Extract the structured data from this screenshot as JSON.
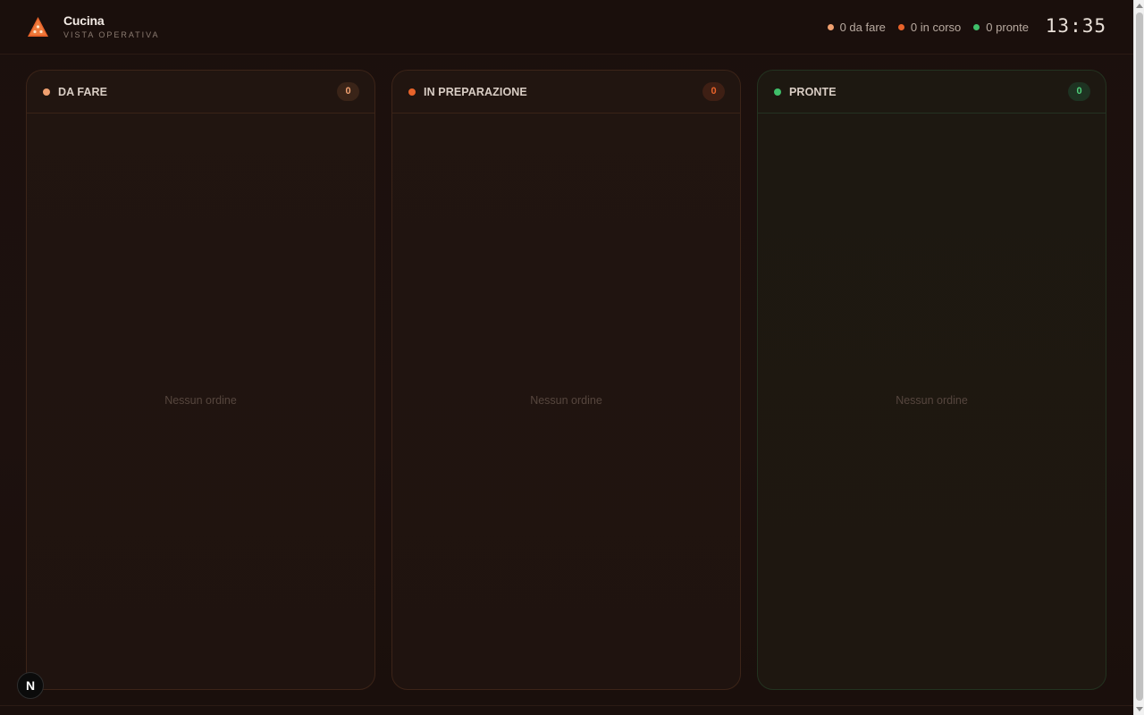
{
  "brand": {
    "title": "Cucina",
    "subtitle": "VISTA OPERATIVA"
  },
  "stats": [
    {
      "label": "0 da fare",
      "color": "#f0a070"
    },
    {
      "label": "0 in corso",
      "color": "#e8632a"
    },
    {
      "label": "0 pronte",
      "color": "#3fbf6a"
    }
  ],
  "clock": "13:35",
  "columns": [
    {
      "title": "DA FARE",
      "count": "0",
      "empty": "Nessun ordine",
      "dot": "#f0a070",
      "badge_bg": "#3a2418",
      "badge_fg": "#f0a070"
    },
    {
      "title": "IN PREPARAZIONE",
      "count": "0",
      "empty": "Nessun ordine",
      "dot": "#e8632a",
      "badge_bg": "#3e1f14",
      "badge_fg": "#e8632a"
    },
    {
      "title": "PRONTE",
      "count": "0",
      "empty": "Nessun ordine",
      "dot": "#3fbf6a",
      "badge_bg": "#1e3322",
      "badge_fg": "#4fd07a"
    }
  ],
  "dev_badge": "N",
  "colors": {
    "accent": "#e8632a",
    "background": "#1a0f0c"
  },
  "icons": {
    "logo": "pizza-slice-icon"
  }
}
